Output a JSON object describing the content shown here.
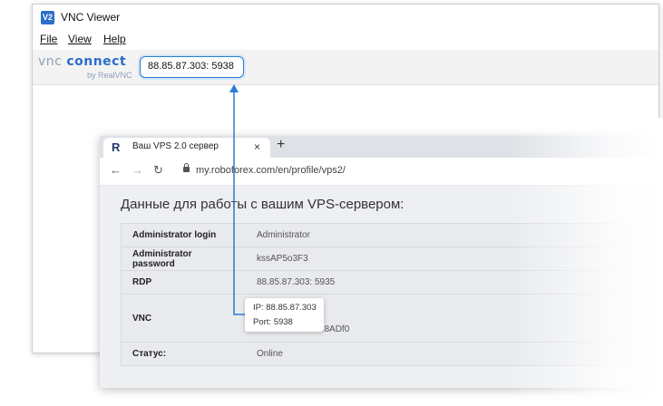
{
  "vnc_window": {
    "icon_text": "V2",
    "title": "VNC Viewer",
    "menu": [
      "File",
      "View",
      "Help"
    ],
    "logo_main_a": "vnc ",
    "logo_main_b": "connect",
    "logo_sub": "by RealVNC",
    "address_value": "88.85.87.303: 5938"
  },
  "browser": {
    "tab_icon": "R",
    "tab_title": "Ваш VPS 2.0 сервер",
    "tab_close": "×",
    "new_tab": "+",
    "url": "my.roboforex.com/en/profile/vps2/",
    "heading": "Данные для работы с вашим VPS-сервером:",
    "rows": [
      {
        "label": "Administrator login",
        "value": "Administrator"
      },
      {
        "label": "Administrator password",
        "value": "kssAP5o3F3"
      },
      {
        "label": "RDP",
        "value": "88.85.87.303: 5935"
      },
      {
        "label": "VNC",
        "value": "Password: 8Axlo8ADf0"
      },
      {
        "label": "Статус:",
        "value": "Online"
      }
    ],
    "status_color": "#2e8b3d"
  },
  "callout": {
    "ip": "IP: 88.85.87.303",
    "port": "Port: 5938"
  },
  "accent_color": "#2b7dd0"
}
